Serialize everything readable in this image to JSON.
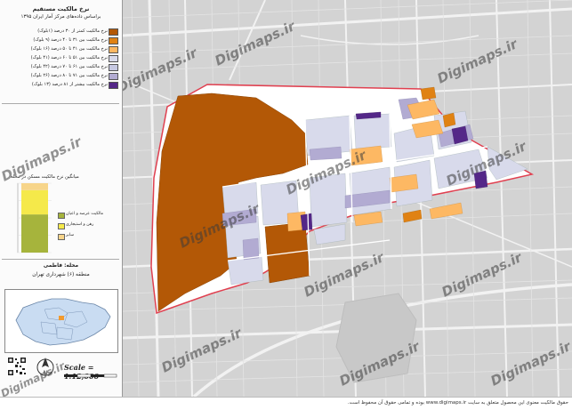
{
  "panel": {
    "title_line1": "نرخ مالکیت مستقیم",
    "title_line2": "براساس داده‌های مرکز آمار ایران ۱۳۹۵",
    "legend": [
      {
        "label": "نرخ مالکیت کمتر از ۳۰ درصد (۱بلوک)",
        "color": "#b35806"
      },
      {
        "label": "نرخ مالکیت بین ۳۱ تا ۴۰ درصد (۹ بلوک)",
        "color": "#e08214"
      },
      {
        "label": "نرخ مالکیت بین ۴۱ تا ۵۰ درصد (۱۶ بلوک)",
        "color": "#fdb863"
      },
      {
        "label": "نرخ مالکیت بین ۵۱ تا ۶۰ درصد (۴۱ بلوک)",
        "color": "#d8daeb"
      },
      {
        "label": "نرخ مالکیت بین ۶۱ تا ۷۰ درصد (۴۲ بلوک)",
        "color": "#c6c8e2"
      },
      {
        "label": "نرخ مالکیت بین ۷۱ تا ۸۰ درصد (۲۶ بلوک)",
        "color": "#b2abd2"
      },
      {
        "label": "نرخ مالکیت بیشتر از ۸۱ درصد (۱۳ بلوک)",
        "color": "#542788"
      }
    ],
    "chart_title": "میانگین نرخ مالکیت مسکن در محله",
    "bar_legend": [
      {
        "label": "مالکیت عرصه و اعیان",
        "color": "#a6b43c"
      },
      {
        "label": "رهن و استیجاری",
        "color": "#f5e94a"
      },
      {
        "label": "سایر",
        "color": "#f7d58a"
      }
    ],
    "neighborhood_line1": "محله: فاطمی",
    "neighborhood_line2": "منطقه (۶) شهرداری تهران",
    "scale": "Scale = 1:12,000"
  },
  "chart_data": {
    "type": "bar",
    "categories": [
      "محله"
    ],
    "series": [
      {
        "name": "مالکیت عرصه و اعیان",
        "values": [
          55
        ]
      },
      {
        "name": "رهن و استیجاری",
        "values": [
          35
        ]
      },
      {
        "name": "سایر",
        "values": [
          10
        ]
      }
    ],
    "ylim": [
      0,
      100
    ]
  },
  "map": {
    "watermark": "Digimaps.ir",
    "colors": {
      "very_low": "#b35806",
      "low": "#e08214",
      "mid_low": "#fdb863",
      "mid": "#d8daeb",
      "mid_high": "#b2abd2",
      "high": "#542788",
      "boundary": "#e04050",
      "road": "#f4f4f4",
      "background": "#d3d3d3"
    }
  },
  "footer": {
    "text": "حقوق مالکیت معنوی این محصول متعلق به سایت www.digimaps.ir بوده و تمامی حقوق آن محفوظ است."
  }
}
